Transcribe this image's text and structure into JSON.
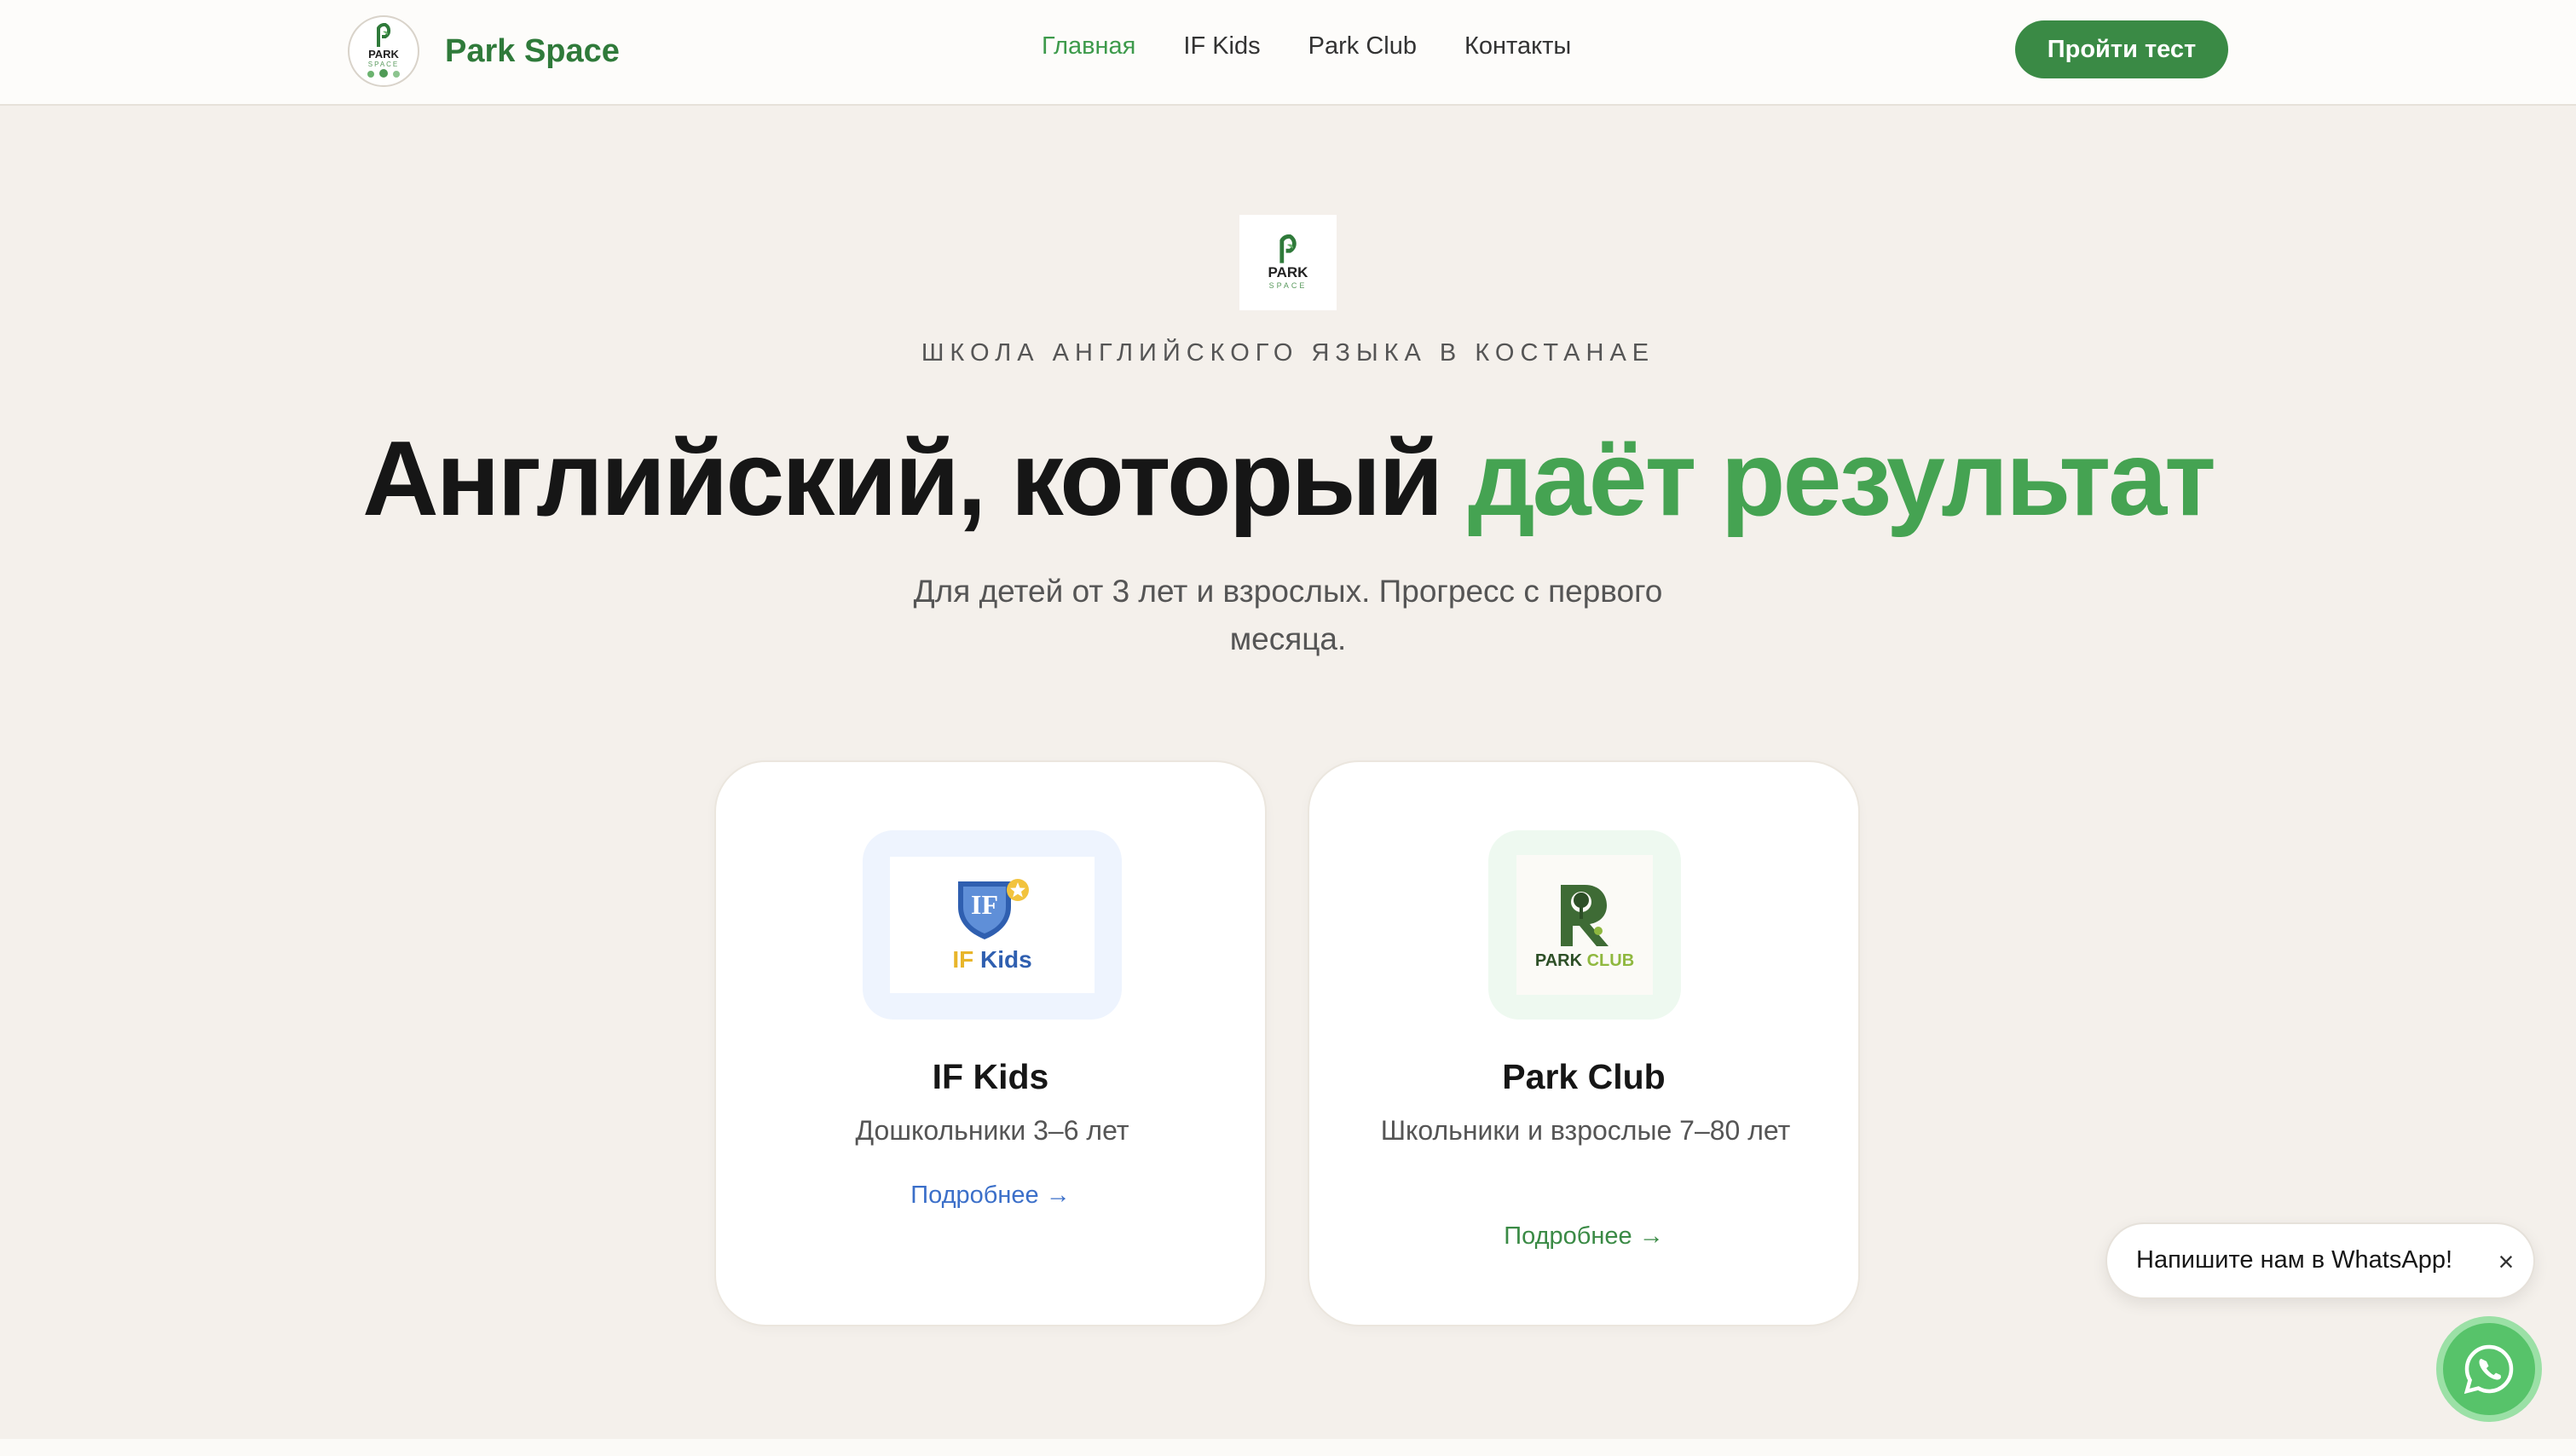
{
  "header": {
    "brand_name": "Park Space",
    "nav": [
      {
        "label": "Главная",
        "active": true
      },
      {
        "label": "IF Kids",
        "active": false
      },
      {
        "label": "Park Club",
        "active": false
      },
      {
        "label": "Контакты",
        "active": false
      }
    ],
    "cta_label": "Пройти тест"
  },
  "logos": {
    "park_space": {
      "line1": "PARK",
      "line2": "SPACE"
    },
    "if_kids": {
      "shield": "IF",
      "word1": "IF",
      "word2": "Kids"
    },
    "park_club": {
      "line1": "PARK",
      "line2": "CLUB"
    }
  },
  "hero": {
    "eyebrow": "ШКОЛА АНГЛИЙСКОГО ЯЗЫКА В КОСТАНАЕ",
    "title_plain": "Английский, который",
    "title_accent": "даёт результат",
    "subtitle": "Для детей от 3 лет и взрослых. Прогресс с первого месяца."
  },
  "cards": [
    {
      "title": "IF Kids",
      "description": "Дошкольники 3–6 лет",
      "link": "Подробнее →"
    },
    {
      "title": "Park Club",
      "description": "Школьники и взрослые 7–80 лет",
      "link": "Подробнее →"
    }
  ],
  "whatsapp": {
    "bubble_text": "Напишите нам в WhatsApp!",
    "close_glyph": "×"
  },
  "colors": {
    "brand_green": "#3a8a45",
    "accent_green": "#45a352",
    "link_blue": "#3b6fc9",
    "background": "#f4f0eb",
    "whatsapp_green": "#57c36a"
  }
}
